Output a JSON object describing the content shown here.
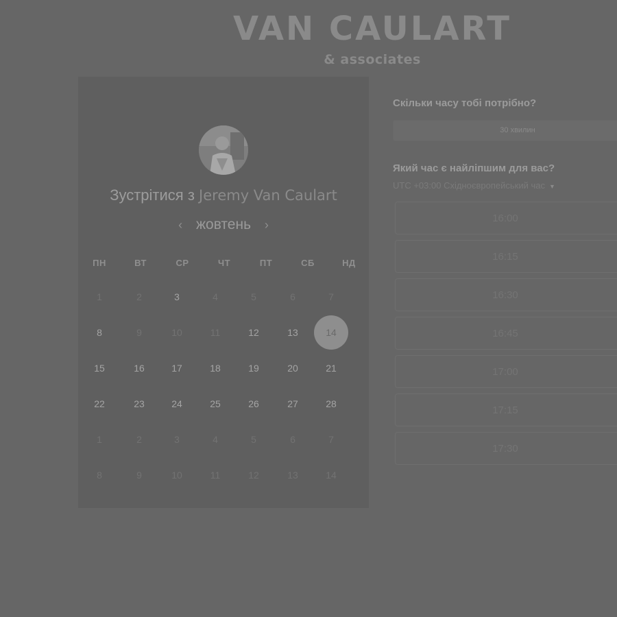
{
  "logo": {
    "main": "VAN CAULART",
    "sub": "& associates"
  },
  "booking": {
    "title_prefix": "Зустрітися з",
    "host_name": "Jeremy Van Caulart",
    "month": "жовтень",
    "prev_icon": "chevron-left-icon",
    "next_icon": "chevron-right-icon",
    "weekdays": [
      "ПН",
      "ВТ",
      "СР",
      "ЧТ",
      "ПТ",
      "СБ",
      "НД"
    ],
    "days": [
      [
        "1",
        "2",
        "3",
        "4",
        "5",
        "6",
        "7"
      ],
      [
        "8",
        "9",
        "10",
        "11",
        "12",
        "13",
        "14"
      ],
      [
        "15",
        "16",
        "17",
        "18",
        "19",
        "20",
        "21"
      ],
      [
        "22",
        "23",
        "24",
        "25",
        "26",
        "27",
        "28"
      ],
      [
        "1",
        "2",
        "3",
        "4",
        "5",
        "6",
        "7"
      ],
      [
        "8",
        "9",
        "10",
        "11",
        "12",
        "13",
        "14"
      ]
    ],
    "available_days": [
      "3",
      "8",
      "12",
      "13",
      "15",
      "16",
      "17",
      "18",
      "19",
      "20",
      "21",
      "22",
      "23",
      "24",
      "25",
      "26",
      "27",
      "28"
    ],
    "selected_day": "14"
  },
  "duration": {
    "question": "Скільки часу тобі потрібно?",
    "selected": "30 хвилин"
  },
  "time": {
    "question": "Який час є найліпшим для вас?",
    "timezone": "UTC +03:00 Східноєвропейський час",
    "slots": [
      "16:00",
      "16:15",
      "16:30",
      "16:45",
      "17:00",
      "17:15",
      "17:30"
    ]
  },
  "colors": {
    "background": "#666666",
    "card": "#5f5f5f",
    "selected_day": "#8e8e8e"
  }
}
